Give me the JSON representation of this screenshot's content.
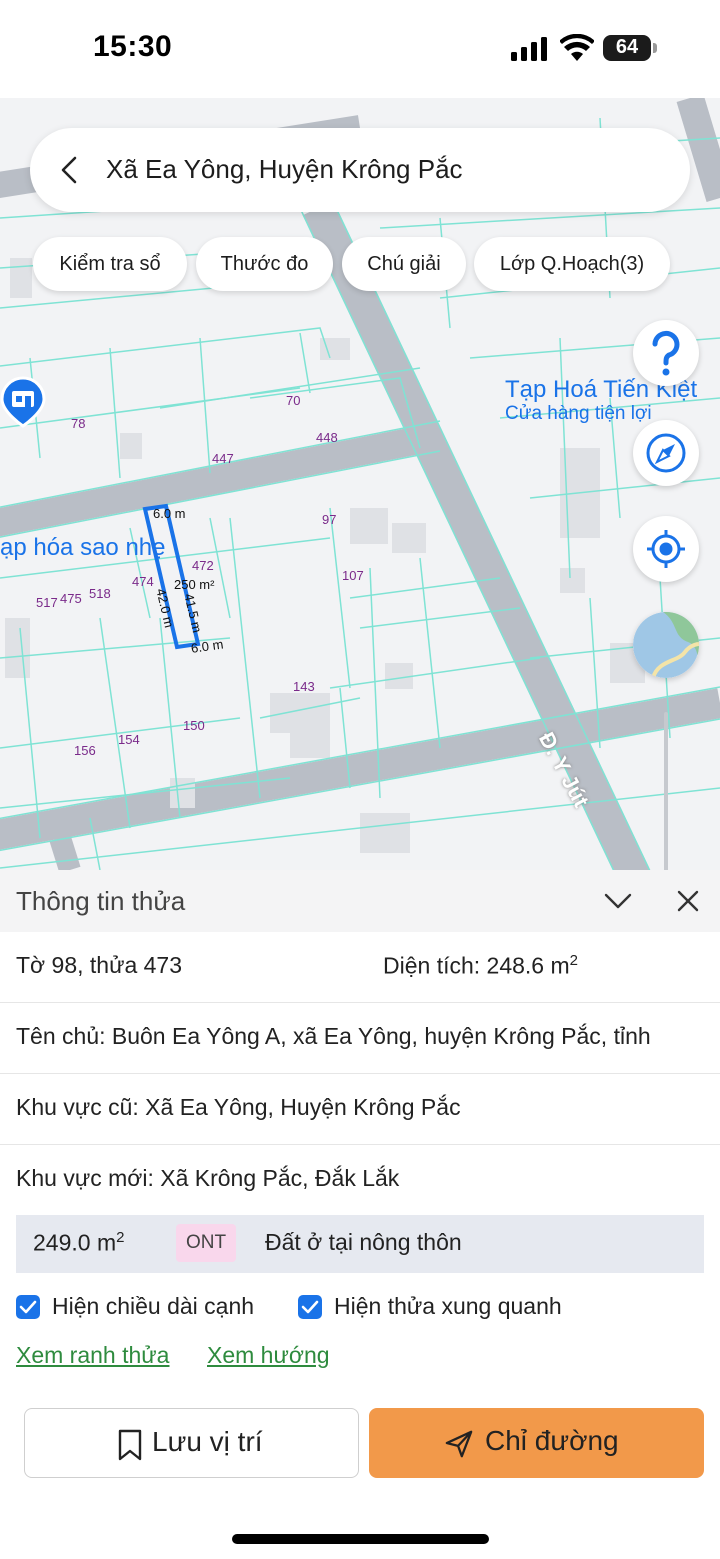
{
  "status_bar": {
    "time": "15:30",
    "battery": "64"
  },
  "search_bar": {
    "title": "Xã Ea Yông, Huyện Krông Pắc"
  },
  "chips": [
    {
      "label": "Kiểm tra sổ"
    },
    {
      "label": "Thước đo"
    },
    {
      "label": "Chú giải"
    },
    {
      "label": "Lớp Q.Hoạch(3)"
    }
  ],
  "map": {
    "poi_name": "Tạp Hoá Tiến Kiệt",
    "poi_category": "Cửa hàng tiện lợi",
    "poi_left": "ạp hóa sao nhẹ",
    "road_name": "Đ. Y Jút",
    "parcel_numbers": [
      "70",
      "78",
      "448",
      "447",
      "97",
      "472",
      "474",
      "107",
      "517",
      "475",
      "518",
      "143",
      "150",
      "156",
      "154"
    ],
    "selected_parcel": {
      "area_label": "250 m²",
      "edge_top": "6.0 m",
      "edge_bottom": "6.0 m",
      "edge_left": "42.0 m",
      "edge_right": "41.5 m"
    }
  },
  "sheet": {
    "title": "Thông tin thửa",
    "sheet_info": "Tờ 98, thửa 473",
    "area_label": "Diện tích: 248.6 m",
    "area_sup": "2",
    "owner": "Tên chủ: Buôn Ea Yông A, xã Ea Yông, huyện Krông Pắc, tỉnh",
    "old_region": "Khu vực cũ: Xã Ea Yông, Huyện Krông Pắc",
    "new_region": "Khu vực mới: Xã Krông Pắc, Đắk Lắk",
    "land": {
      "area": "249.0 m",
      "area_sup": "2",
      "code": "ONT",
      "type": "Đất ở tại nông thôn"
    },
    "checkboxes": [
      {
        "label": "Hiện chiều dài cạnh",
        "checked": true
      },
      {
        "label": "Hiện thửa xung quanh",
        "checked": true
      }
    ],
    "links": {
      "boundary": "Xem ranh thửa",
      "direction": "Xem hướng"
    },
    "buttons": {
      "save": "Lưu vị trí",
      "directions": "Chỉ đường"
    }
  },
  "colors": {
    "accent_blue": "#1a73e8",
    "orange": "#f2994a",
    "link_green": "#2e8b3e",
    "parcel_line": "#7fe3d4"
  }
}
